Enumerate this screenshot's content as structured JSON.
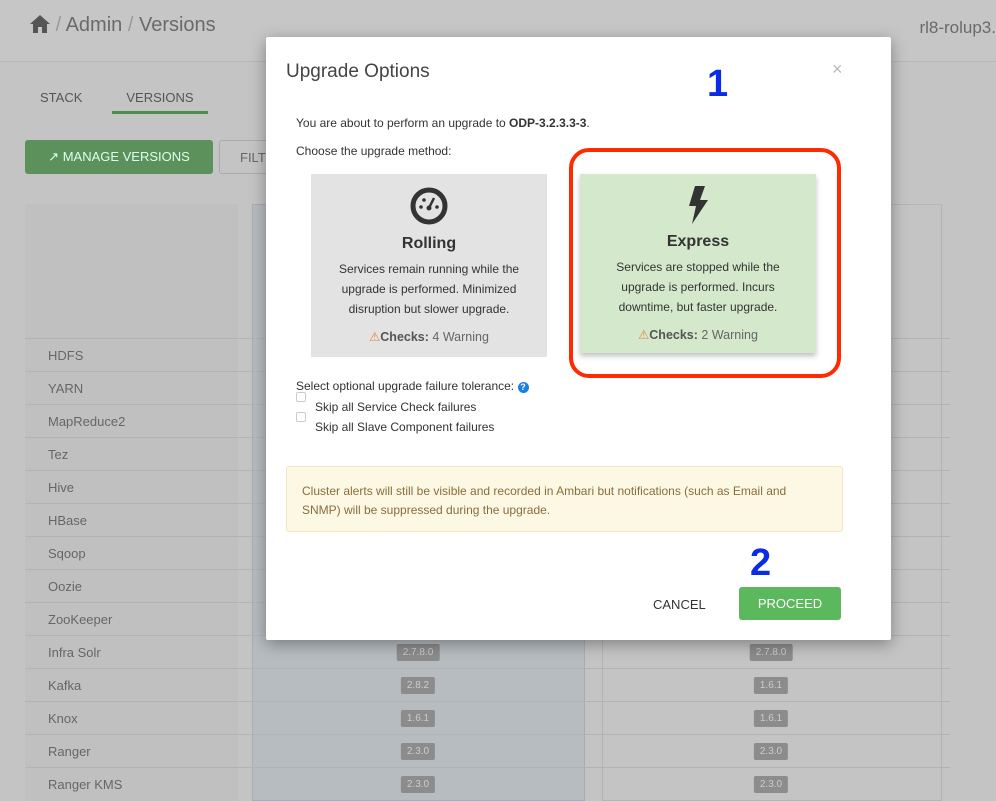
{
  "header": {
    "breadcrumb_admin": "Admin",
    "breadcrumb_versions": "Versions",
    "sep": "/",
    "host": "rl8-rolup3."
  },
  "tabs": [
    {
      "label": "STACK"
    },
    {
      "label": "VERSIONS"
    }
  ],
  "toolbar": {
    "manage_versions": "MANAGE VERSIONS",
    "filter": "FILT"
  },
  "services": [
    {
      "name": "HDFS"
    },
    {
      "name": "YARN"
    },
    {
      "name": "MapReduce2"
    },
    {
      "name": "Tez"
    },
    {
      "name": "Hive"
    },
    {
      "name": "HBase"
    },
    {
      "name": "Sqoop"
    },
    {
      "name": "Oozie"
    },
    {
      "name": "ZooKeeper"
    },
    {
      "name": "Infra Solr",
      "v1": "2.7.8.0",
      "v2": "2.7.8.0"
    },
    {
      "name": "Kafka",
      "v1": "2.8.2",
      "v2": "1.6.1"
    },
    {
      "name": "Knox",
      "v1": "1.6.1",
      "v2": "1.6.1"
    },
    {
      "name": "Ranger",
      "v1": "2.3.0",
      "v2": "2.3.0"
    },
    {
      "name": "Ranger KMS",
      "v1": "2.3.0",
      "v2": "2.3.0"
    }
  ],
  "modal": {
    "title": "Upgrade Options",
    "close": "×",
    "intro_prefix": "You are about to perform an upgrade to ",
    "intro_version": "ODP-3.2.3.3-3",
    "intro_suffix": ".",
    "choose": "Choose the upgrade method:",
    "rolling": {
      "title": "Rolling",
      "desc": "Services remain running while the upgrade is performed. Minimized disruption but slower upgrade.",
      "checks_label": "Checks:",
      "checks_value": "4 Warning"
    },
    "express": {
      "title": "Express",
      "desc": "Services are stopped while the upgrade is performed. Incurs downtime, but faster upgrade.",
      "checks_label": "Checks:",
      "checks_value": "2 Warning"
    },
    "tolerance_label": "Select optional upgrade failure tolerance:",
    "skip_service_checks": "Skip all Service Check failures",
    "skip_slave_failures": "Skip all Slave Component failures",
    "alert": "Cluster alerts will still be visible and recorded in Ambari but notifications (such as Email and SNMP) will be suppressed during the upgrade.",
    "cancel": "CANCEL",
    "proceed": "PROCEED"
  },
  "annotations": {
    "step1": "1",
    "step2": "2"
  }
}
